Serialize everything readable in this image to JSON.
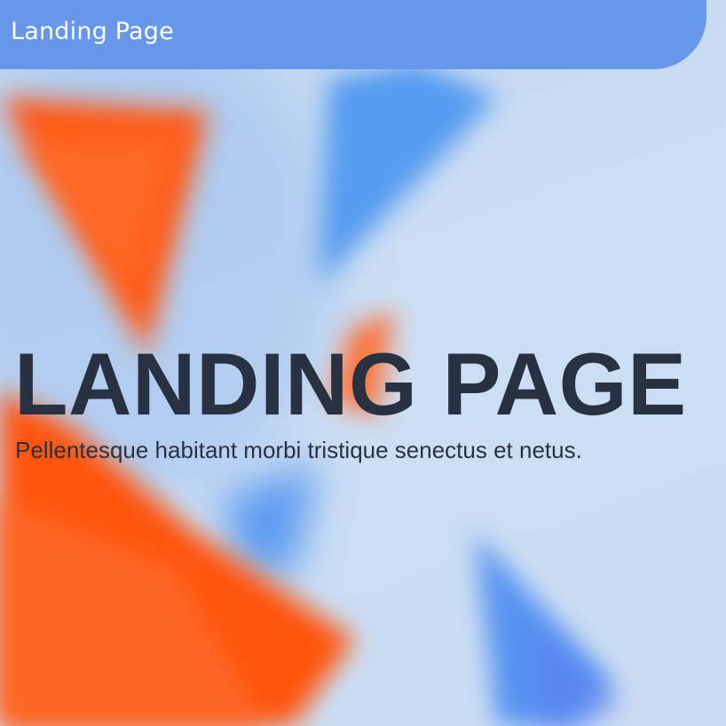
{
  "navbar": {
    "brand": "Landing Page",
    "background_color": "#6797ea"
  },
  "hero": {
    "title": "LANDING PAGE",
    "subtitle": "Pellentesque habitant morbi tristique senectus et netus.",
    "text_color": "#283142",
    "background_image": "blurred-abstract-orange-blue-shapes"
  },
  "colors": {
    "page_background": "#cfdff3",
    "accent_orange": "#ff5a14",
    "accent_blue": "#4f94ee"
  }
}
